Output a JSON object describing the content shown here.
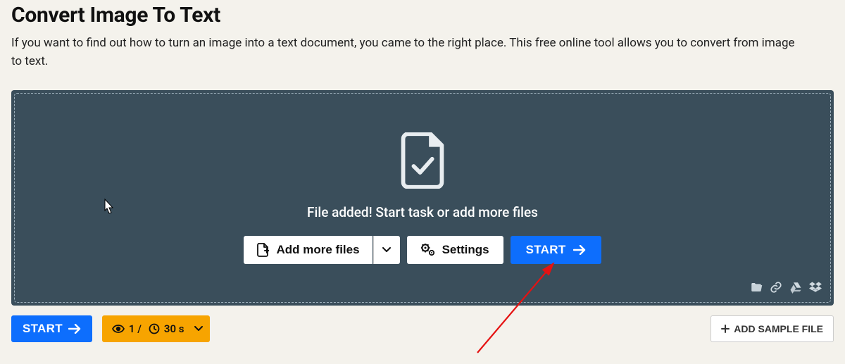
{
  "heading": "Convert Image To Text",
  "intro": "If you want to find out how to turn an image into a text document, you came to the right place. This free online tool allows you to convert from image to text.",
  "dropzone": {
    "status": "File added! Start task or add more files",
    "add_more": "Add more files",
    "settings": "Settings",
    "start": "START"
  },
  "bottom": {
    "start": "START",
    "counter_prefix": "1 /",
    "timer": "30 s",
    "sample": "ADD SAMPLE FILE"
  }
}
